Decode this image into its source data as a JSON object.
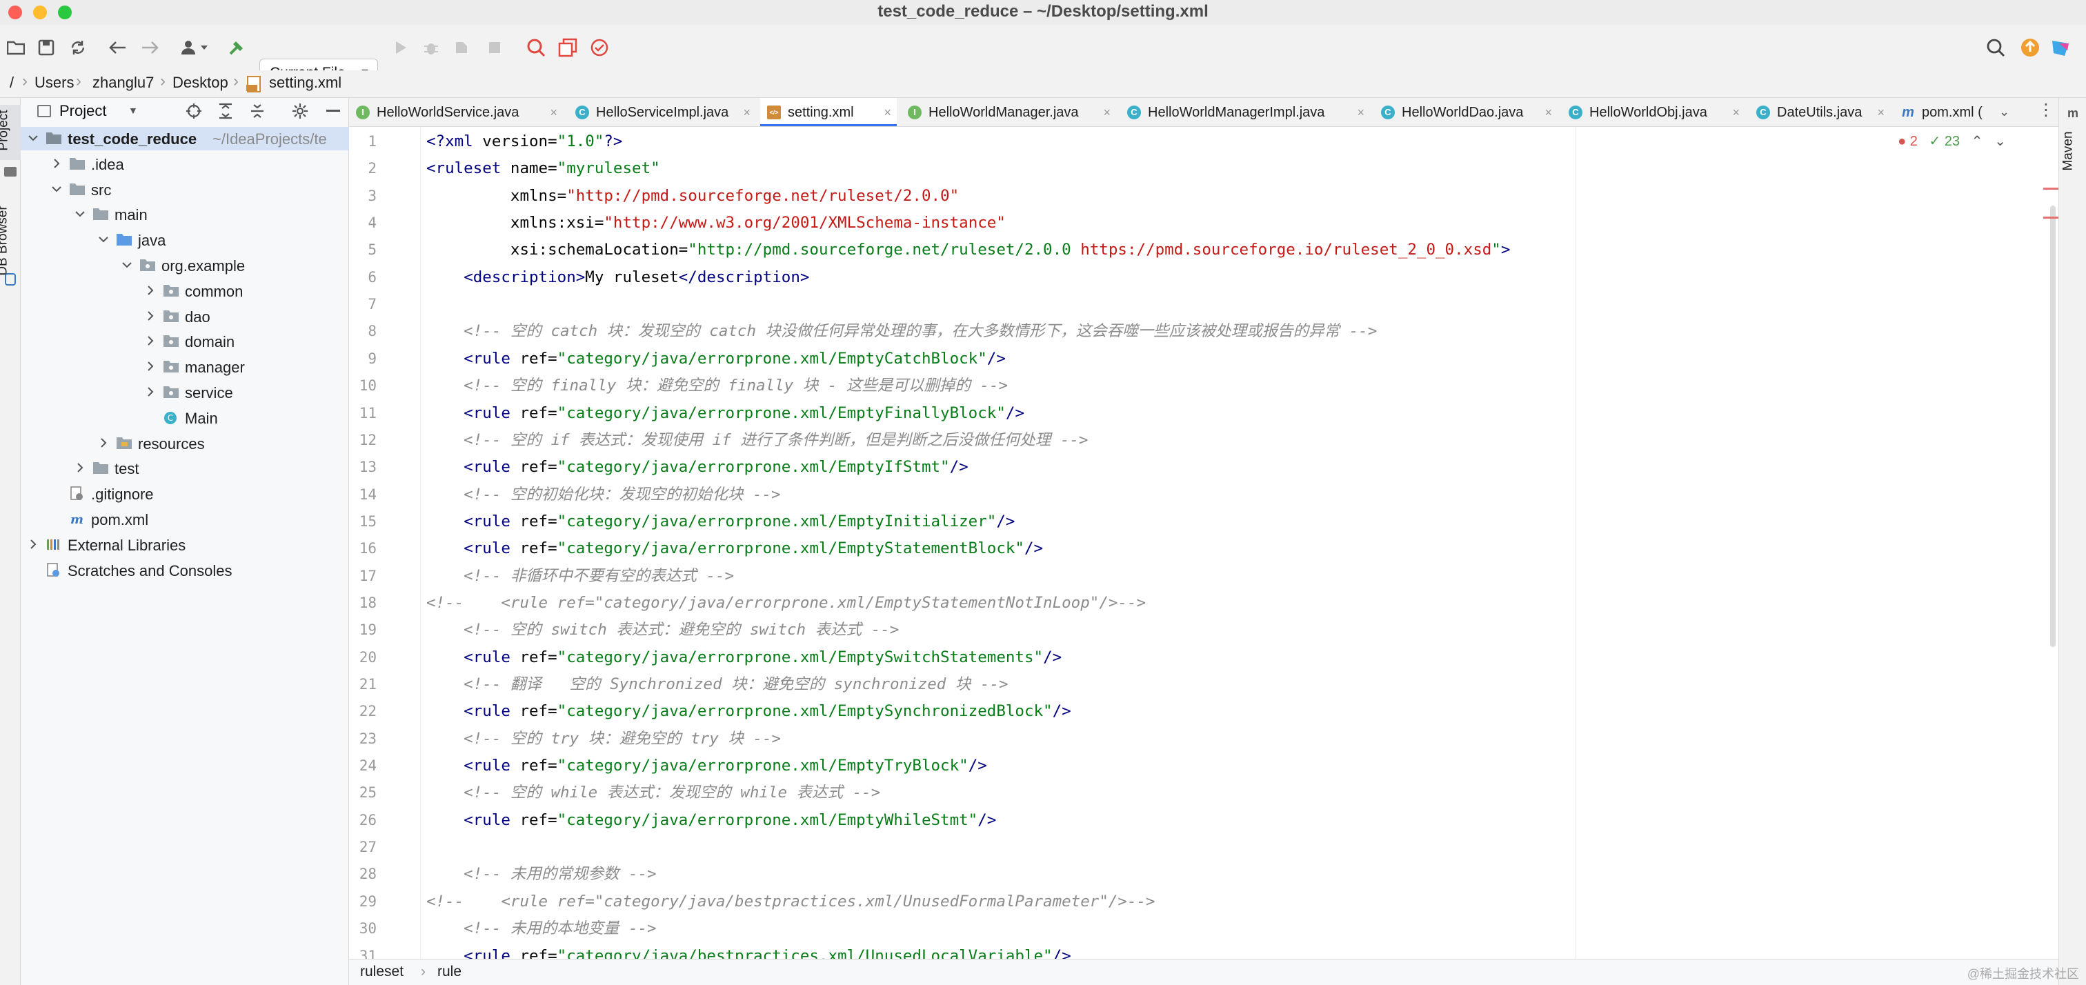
{
  "window": {
    "title": "test_code_reduce – ~/Desktop/setting.xml"
  },
  "toolbar": {
    "run_config": "Current File"
  },
  "breadcrumb": [
    "/",
    "Users",
    "zhanglu7",
    "Desktop",
    "setting.xml"
  ],
  "left_strip": {
    "project_tab": "Project",
    "db_tab": "DB Browser"
  },
  "right_strip": {
    "maven_tab": "Maven"
  },
  "project_panel": {
    "title": "Project",
    "tree": [
      {
        "label": "test_code_reduce",
        "suffix": " ~/IdeaProjects/te",
        "icon": "module-folder-icon",
        "bold": true,
        "selected": true
      },
      {
        "label": ".idea",
        "icon": "folder-icon"
      },
      {
        "label": "src",
        "icon": "folder-icon"
      },
      {
        "label": "main",
        "icon": "folder-icon"
      },
      {
        "label": "java",
        "icon": "source-folder-icon"
      },
      {
        "label": "org.example",
        "icon": "package-icon"
      },
      {
        "label": "common",
        "icon": "package-icon"
      },
      {
        "label": "dao",
        "icon": "package-icon"
      },
      {
        "label": "domain",
        "icon": "package-icon"
      },
      {
        "label": "manager",
        "icon": "package-icon"
      },
      {
        "label": "service",
        "icon": "package-icon"
      },
      {
        "label": "Main",
        "icon": "java-class-icon"
      },
      {
        "label": "resources",
        "icon": "resources-folder-icon"
      },
      {
        "label": "test",
        "icon": "folder-icon"
      },
      {
        "label": ".gitignore",
        "icon": "gitignore-file-icon"
      },
      {
        "label": "pom.xml",
        "icon": "maven-file-icon"
      },
      {
        "label": "External Libraries",
        "icon": "libraries-icon"
      },
      {
        "label": "Scratches and Consoles",
        "icon": "scratches-icon"
      }
    ]
  },
  "tabs": [
    {
      "label": "HelloWorldService.java",
      "kind": "interface"
    },
    {
      "label": "HelloServiceImpl.java",
      "kind": "class"
    },
    {
      "label": "setting.xml",
      "kind": "xml",
      "active": true
    },
    {
      "label": "HelloWorldManager.java",
      "kind": "interface"
    },
    {
      "label": "HelloWorldManagerImpl.java",
      "kind": "class"
    },
    {
      "label": "HelloWorldDao.java",
      "kind": "class"
    },
    {
      "label": "HelloWorldObj.java",
      "kind": "class"
    },
    {
      "label": "DateUtils.java",
      "kind": "class"
    },
    {
      "label": "pom.xml (",
      "kind": "maven"
    }
  ],
  "inspection": {
    "errors": "2",
    "warnings": "23"
  },
  "editor": {
    "lines": [
      {
        "n": "1",
        "t": "<?xml version=\"1.0\"?>"
      },
      {
        "n": "2",
        "t": "<ruleset name=\"myruleset\""
      },
      {
        "n": "3",
        "t": "         xmlns=\"http://pmd.sourceforge.net/ruleset/2.0.0\""
      },
      {
        "n": "4",
        "t": "         xmlns:xsi=\"http://www.w3.org/2001/XMLSchema-instance\""
      },
      {
        "n": "5",
        "t": "         xsi:schemaLocation=\"http://pmd.sourceforge.net/ruleset/2.0.0 https://pmd.sourceforge.io/ruleset_2_0_0.xsd\">"
      },
      {
        "n": "6",
        "t": "    <description>My ruleset</description>"
      },
      {
        "n": "7",
        "t": ""
      },
      {
        "n": "8",
        "t": "    <!-- 空的 catch 块：发现空的 catch 块没做任何异常处理的事，在大多数情形下，这会吞噬一些应该被处理或报告的异常 -->"
      },
      {
        "n": "9",
        "t": "    <rule ref=\"category/java/errorprone.xml/EmptyCatchBlock\"/>"
      },
      {
        "n": "10",
        "t": "    <!-- 空的 finally 块：避免空的 finally 块 - 这些是可以删掉的 -->"
      },
      {
        "n": "11",
        "t": "    <rule ref=\"category/java/errorprone.xml/EmptyFinallyBlock\"/>"
      },
      {
        "n": "12",
        "t": "    <!-- 空的 if 表达式：发现使用 if 进行了条件判断，但是判断之后没做任何处理 -->"
      },
      {
        "n": "13",
        "t": "    <rule ref=\"category/java/errorprone.xml/EmptyIfStmt\"/>"
      },
      {
        "n": "14",
        "t": "    <!-- 空的初始化块：发现空的初始化块 -->"
      },
      {
        "n": "15",
        "t": "    <rule ref=\"category/java/errorprone.xml/EmptyInitializer\"/>"
      },
      {
        "n": "16",
        "t": "    <rule ref=\"category/java/errorprone.xml/EmptyStatementBlock\"/>"
      },
      {
        "n": "17",
        "t": "    <!-- 非循环中不要有空的表达式 -->"
      },
      {
        "n": "18",
        "t": "<!--    <rule ref=\"category/java/errorprone.xml/EmptyStatementNotInLoop\"/>-->"
      },
      {
        "n": "19",
        "t": "    <!-- 空的 switch 表达式：避免空的 switch 表达式 -->"
      },
      {
        "n": "20",
        "t": "    <rule ref=\"category/java/errorprone.xml/EmptySwitchStatements\"/>"
      },
      {
        "n": "21",
        "t": "    <!-- 翻译   空的 Synchronized 块：避免空的 synchronized 块 -->"
      },
      {
        "n": "22",
        "t": "    <rule ref=\"category/java/errorprone.xml/EmptySynchronizedBlock\"/>"
      },
      {
        "n": "23",
        "t": "    <!-- 空的 try 块：避免空的 try 块 -->"
      },
      {
        "n": "24",
        "t": "    <rule ref=\"category/java/errorprone.xml/EmptyTryBlock\"/>"
      },
      {
        "n": "25",
        "t": "    <!-- 空的 while 表达式：发现空的 while 表达式 -->"
      },
      {
        "n": "26",
        "t": "    <rule ref=\"category/java/errorprone.xml/EmptyWhileStmt\"/>"
      },
      {
        "n": "27",
        "t": ""
      },
      {
        "n": "28",
        "t": "    <!-- 未用的常规参数 -->"
      },
      {
        "n": "29",
        "t": "<!--    <rule ref=\"category/java/bestpractices.xml/UnusedFormalParameter\"/>-->"
      },
      {
        "n": "30",
        "t": "    <!-- 未用的本地变量 -->"
      },
      {
        "n": "31",
        "t": "    <rule ref=\"category/java/bestpractices.xml/UnusedLocalVariable\"/>"
      }
    ]
  },
  "statusbar": {
    "crumbs": [
      "ruleset",
      "rule"
    ]
  },
  "watermark": "@稀土掘金技术社区",
  "colors": {
    "accent": "#3574f0",
    "tag": "#000080",
    "attr": "#174ad4",
    "string": "#067d17",
    "comment": "#8c8c8c",
    "error": "#c41a16"
  }
}
